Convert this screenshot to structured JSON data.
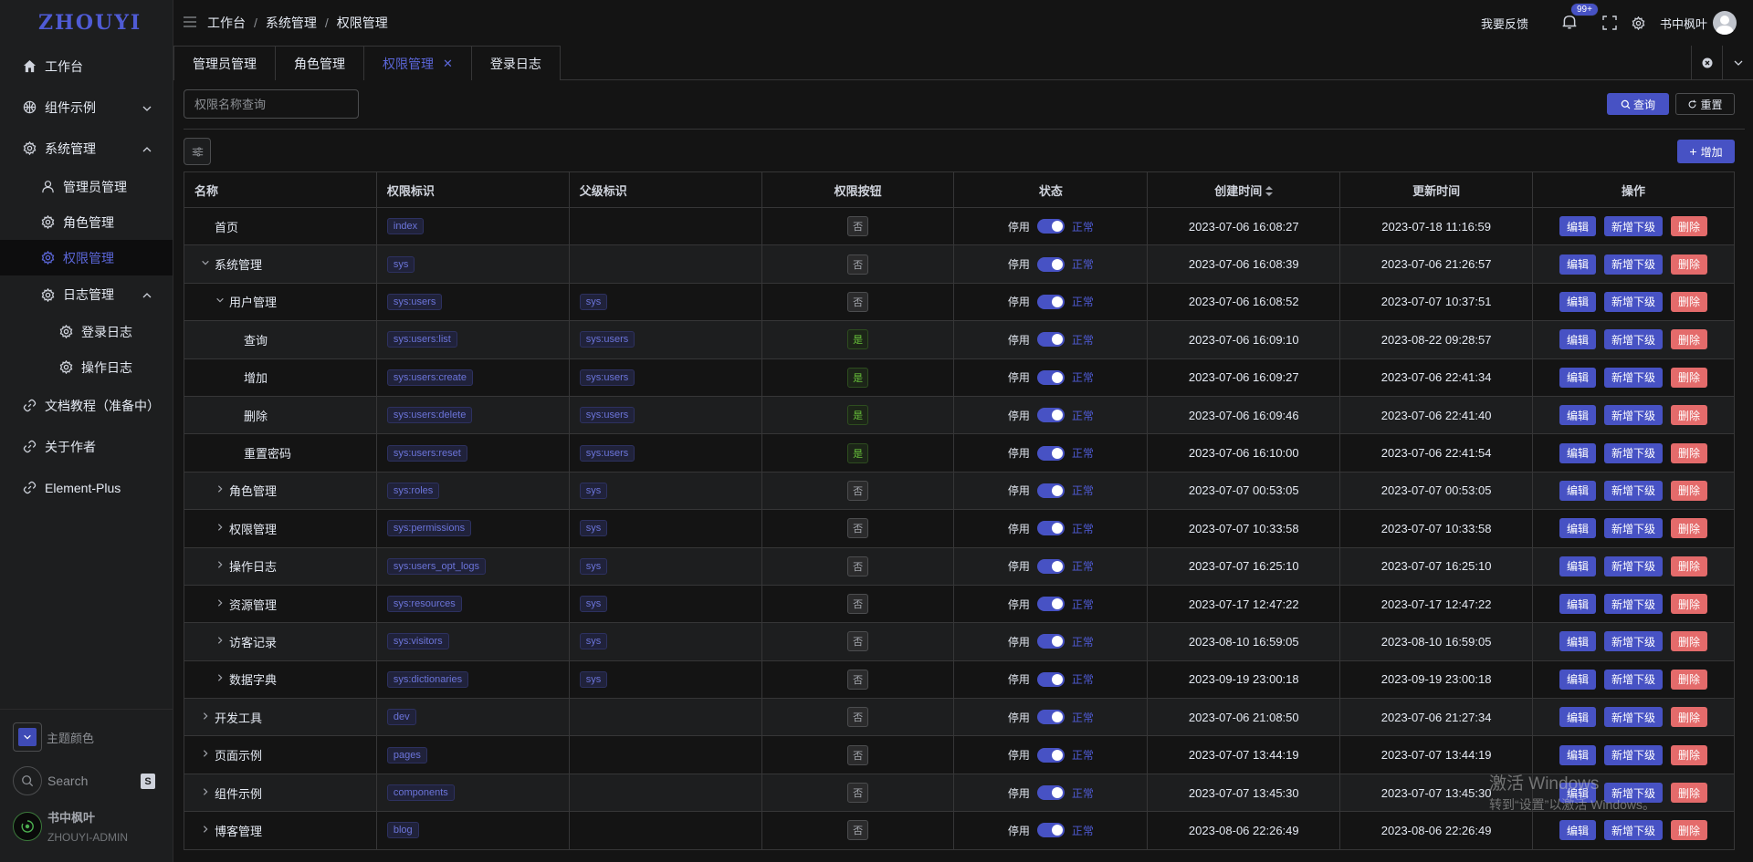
{
  "app": {
    "logo": "ZHOUYI"
  },
  "sidebar": {
    "items": [
      {
        "label": "工作台",
        "icon": "home-icon"
      },
      {
        "label": "组件示例",
        "icon": "basketball-icon"
      },
      {
        "label": "系统管理",
        "icon": "gear-icon"
      },
      {
        "label": "管理员管理",
        "icon": "user-icon"
      },
      {
        "label": "角色管理",
        "icon": "gear-icon"
      },
      {
        "label": "权限管理",
        "icon": "gear-icon"
      },
      {
        "label": "日志管理",
        "icon": "gear-icon"
      },
      {
        "label": "登录日志",
        "icon": "gear-icon"
      },
      {
        "label": "操作日志",
        "icon": "gear-icon"
      },
      {
        "label": "文档教程（准备中）",
        "icon": "link-icon"
      },
      {
        "label": "关于作者",
        "icon": "link-icon"
      },
      {
        "label": "Element-Plus",
        "icon": "link-icon"
      }
    ],
    "theme_label": "主题颜色",
    "search_label": "Search",
    "search_key": "S",
    "user_name": "书中枫叶",
    "user_role": "ZHOUYI-ADMIN"
  },
  "header": {
    "breadcrumb": [
      "工作台",
      "系统管理",
      "权限管理"
    ],
    "feedback": "我要反馈",
    "notify_count": "99+",
    "username": "书中枫叶"
  },
  "tabs": [
    {
      "label": "管理员管理"
    },
    {
      "label": "角色管理"
    },
    {
      "label": "权限管理"
    },
    {
      "label": "登录日志"
    }
  ],
  "toolbar": {
    "search_placeholder": "权限名称查询",
    "query_label": "查询",
    "reset_label": "重置",
    "add_label": "增加"
  },
  "table": {
    "columns": [
      "名称",
      "权限标识",
      "父级标识",
      "权限按钮",
      "状态",
      "创建时间",
      "更新时间",
      "操作"
    ],
    "status_off": "停用",
    "status_on": "正常",
    "op_edit": "编辑",
    "op_add_child": "新增下级",
    "op_delete": "删除",
    "rows": [
      {
        "name": "首页",
        "perm": "index",
        "parent": "",
        "button": "否",
        "created": "2023-07-06 16:08:27",
        "updated": "2023-07-18 11:16:59"
      },
      {
        "name": "系统管理",
        "perm": "sys",
        "parent": "",
        "button": "否",
        "created": "2023-07-06 16:08:39",
        "updated": "2023-07-06 21:26:57"
      },
      {
        "name": "用户管理",
        "perm": "sys:users",
        "parent": "sys",
        "button": "否",
        "created": "2023-07-06 16:08:52",
        "updated": "2023-07-07 10:37:51"
      },
      {
        "name": "查询",
        "perm": "sys:users:list",
        "parent": "sys:users",
        "button": "是",
        "created": "2023-07-06 16:09:10",
        "updated": "2023-08-22 09:28:57"
      },
      {
        "name": "增加",
        "perm": "sys:users:create",
        "parent": "sys:users",
        "button": "是",
        "created": "2023-07-06 16:09:27",
        "updated": "2023-07-06 22:41:34"
      },
      {
        "name": "删除",
        "perm": "sys:users:delete",
        "parent": "sys:users",
        "button": "是",
        "created": "2023-07-06 16:09:46",
        "updated": "2023-07-06 22:41:40"
      },
      {
        "name": "重置密码",
        "perm": "sys:users:reset",
        "parent": "sys:users",
        "button": "是",
        "created": "2023-07-06 16:10:00",
        "updated": "2023-07-06 22:41:54"
      },
      {
        "name": "角色管理",
        "perm": "sys:roles",
        "parent": "sys",
        "button": "否",
        "created": "2023-07-07 00:53:05",
        "updated": "2023-07-07 00:53:05"
      },
      {
        "name": "权限管理",
        "perm": "sys:permissions",
        "parent": "sys",
        "button": "否",
        "created": "2023-07-07 10:33:58",
        "updated": "2023-07-07 10:33:58"
      },
      {
        "name": "操作日志",
        "perm": "sys:users_opt_logs",
        "parent": "sys",
        "button": "否",
        "created": "2023-07-07 16:25:10",
        "updated": "2023-07-07 16:25:10"
      },
      {
        "name": "资源管理",
        "perm": "sys:resources",
        "parent": "sys",
        "button": "否",
        "created": "2023-07-17 12:47:22",
        "updated": "2023-07-17 12:47:22"
      },
      {
        "name": "访客记录",
        "perm": "sys:visitors",
        "parent": "sys",
        "button": "否",
        "created": "2023-08-10 16:59:05",
        "updated": "2023-08-10 16:59:05"
      },
      {
        "name": "数据字典",
        "perm": "sys:dictionaries",
        "parent": "sys",
        "button": "否",
        "created": "2023-09-19 23:00:18",
        "updated": "2023-09-19 23:00:18"
      },
      {
        "name": "开发工具",
        "perm": "dev",
        "parent": "",
        "button": "否",
        "created": "2023-07-06 21:08:50",
        "updated": "2023-07-06 21:27:34"
      },
      {
        "name": "页面示例",
        "perm": "pages",
        "parent": "",
        "button": "否",
        "created": "2023-07-07 13:44:19",
        "updated": "2023-07-07 13:44:19"
      },
      {
        "name": "组件示例",
        "perm": "components",
        "parent": "",
        "button": "否",
        "created": "2023-07-07 13:45:30",
        "updated": "2023-07-07 13:45:30"
      },
      {
        "name": "博客管理",
        "perm": "blog",
        "parent": "",
        "button": "否",
        "created": "2023-08-06 22:26:49",
        "updated": "2023-08-06 22:26:49"
      }
    ]
  },
  "watermark": {
    "line1": "激活 Windows",
    "line2": "转到“设置”以激活 Windows。"
  }
}
